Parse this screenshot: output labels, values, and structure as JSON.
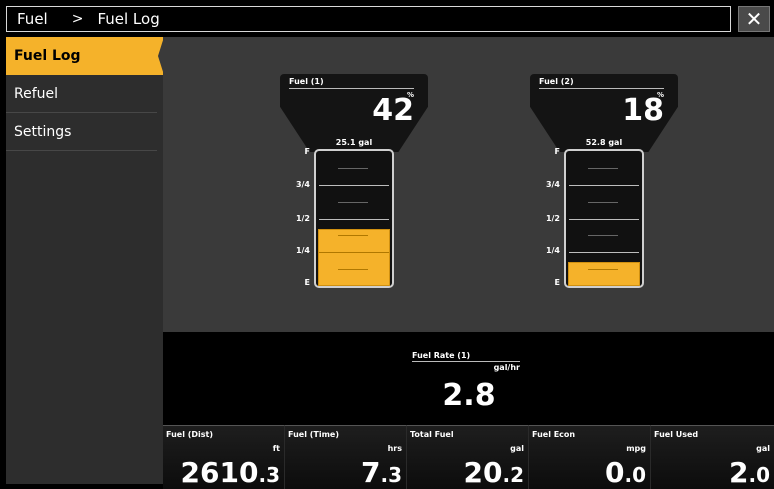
{
  "breadcrumb": {
    "root": "Fuel",
    "separator": ">",
    "current": "Fuel Log"
  },
  "close_icon": "close-icon",
  "sidebar": {
    "items": [
      {
        "label": "Fuel Log",
        "active": true
      },
      {
        "label": "Refuel",
        "active": false
      },
      {
        "label": "Settings",
        "active": false
      }
    ]
  },
  "gauges": [
    {
      "title": "Fuel (1)",
      "unit": "%",
      "value": "42",
      "gallons": "25.1 gal",
      "fill_fraction": 0.42,
      "labels": [
        "F",
        "3/4",
        "1/2",
        "1/4",
        "E"
      ]
    },
    {
      "title": "Fuel (2)",
      "unit": "%",
      "value": "18",
      "gallons": "52.8 gal",
      "fill_fraction": 0.18,
      "labels": [
        "F",
        "3/4",
        "1/2",
        "1/4",
        "E"
      ]
    }
  ],
  "fuel_rate": {
    "title": "Fuel Rate (1)",
    "unit": "gal/hr",
    "value": "2.8"
  },
  "cells": [
    {
      "label": "Fuel (Dist)",
      "unit": "ft",
      "int": "2610",
      "frac": ".3"
    },
    {
      "label": "Fuel (Time)",
      "unit": "hrs",
      "int": "7",
      "frac": ".3"
    },
    {
      "label": "Total Fuel",
      "unit": "gal",
      "int": "20",
      "frac": ".2"
    },
    {
      "label": "Fuel Econ",
      "unit": "mpg",
      "int": "0",
      "frac": ".0"
    },
    {
      "label": "Fuel Used",
      "unit": "gal",
      "int": "2",
      "frac": ".0"
    }
  ],
  "colors": {
    "accent": "#f5b22a",
    "panel": "#3a3a3a",
    "sidebar": "#2d2d2d"
  }
}
